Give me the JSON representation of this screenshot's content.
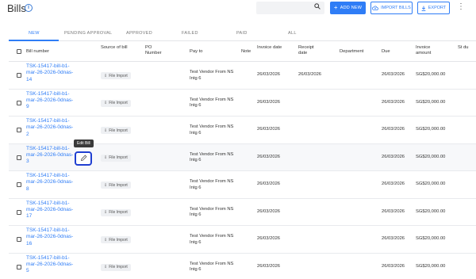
{
  "header": {
    "title": "Bills",
    "add_label": "ADD NEW",
    "import_label": "IMPORT BILLS",
    "export_label": "EXPORT"
  },
  "tabs": [
    {
      "label": "NEW",
      "active": true
    },
    {
      "label": "PENDING APPROVAL"
    },
    {
      "label": "APPROVED"
    },
    {
      "label": "FAILED"
    },
    {
      "label": "PAID"
    },
    {
      "label": "ALL"
    }
  ],
  "columns": {
    "bill_number": "Bill number",
    "source": "Source of bill",
    "po": "PO Number",
    "payto": "Pay to",
    "note": "Note",
    "invoice_date": "Invoice date",
    "receipt_date": "Receipt date",
    "department": "Department",
    "due": "Due",
    "amount": "Invoice amount",
    "status": "St du"
  },
  "tooltip": "Edit Bill",
  "rows": [
    {
      "bill": "TSK-15417-bill-b1-mar-26-2026-0dnas-14",
      "source": "File Import",
      "payto": "Test Vendor From NS Intg 6",
      "invoice_date": "26/03/2026",
      "receipt_date": "26/03/2026",
      "due": "26/03/2026",
      "amount": "SG$20,000.00"
    },
    {
      "bill": "TSK-15417-bill-b1-mar-26-2026-0dnas-9",
      "source": "File Import",
      "payto": "Test Vendor From NS Intg 6",
      "invoice_date": "26/03/2026",
      "receipt_date": "",
      "due": "26/03/2026",
      "amount": "SG$20,000.00"
    },
    {
      "bill": "TSK-15417-bill-b1-mar-26-2026-0dnas-2",
      "source": "File Import",
      "payto": "Test Vendor From NS Intg 6",
      "invoice_date": "26/03/2026",
      "receipt_date": "",
      "due": "26/03/2026",
      "amount": "SG$20,000.00"
    },
    {
      "bill": "TSK-15417-bill-b1-mar-26-2026-0dnas-3",
      "source": "File Import",
      "payto": "Test Vendor From NS Intg 6",
      "invoice_date": "26/03/2026",
      "receipt_date": "",
      "due": "26/03/2026",
      "amount": "SG$20,000.00"
    },
    {
      "bill": "TSK-15417-bill-b1-mar-26-2026-0dnas-8",
      "source": "File Import",
      "payto": "Test Vendor From NS Intg 6",
      "invoice_date": "26/03/2026",
      "receipt_date": "",
      "due": "26/03/2026",
      "amount": "SG$20,000.00"
    },
    {
      "bill": "TSK-15417-bill-b1-mar-26-2026-0dnas-17",
      "source": "File Import",
      "payto": "Test Vendor From NS Intg 6",
      "invoice_date": "26/03/2026",
      "receipt_date": "",
      "due": "26/03/2026",
      "amount": "SG$20,000.00"
    },
    {
      "bill": "TSK-15417-bill-b1-mar-26-2026-0dnas-16",
      "source": "File Import",
      "payto": "Test Vendor From NS Intg 6",
      "invoice_date": "26/03/2026",
      "receipt_date": "",
      "due": "26/03/2026",
      "amount": "SG$20,000.00"
    },
    {
      "bill": "TSK-15417-bill-b1-mar-26-2026-0dnas-5",
      "source": "File Import",
      "payto": "Test Vendor From NS Intg 6",
      "invoice_date": "26/03/2026",
      "receipt_date": "",
      "due": "26/03/2026",
      "amount": "SG$20,000.00"
    }
  ]
}
